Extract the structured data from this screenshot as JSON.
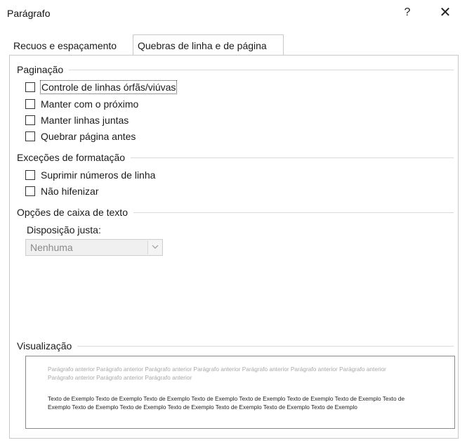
{
  "window": {
    "title": "Parágrafo",
    "help_label": "?",
    "close_label": "✕"
  },
  "tabs": [
    {
      "label": "Recuos e espaçamento",
      "selected": false
    },
    {
      "label": "Quebras de linha e de página",
      "selected": true
    }
  ],
  "pagination": {
    "header": "Paginação",
    "options": [
      {
        "label": "Controle de linhas órfãs/viúvas",
        "checked": false
      },
      {
        "label": "Manter com o próximo",
        "checked": false
      },
      {
        "label": "Manter linhas juntas",
        "checked": false
      },
      {
        "label": "Quebrar página antes",
        "checked": false
      }
    ]
  },
  "exceptions": {
    "header": "Exceções de formatação",
    "options": [
      {
        "label": "Suprimir números de linha",
        "checked": false
      },
      {
        "label": "Não hifenizar",
        "checked": false
      }
    ]
  },
  "textbox": {
    "header": "Opções de caixa de texto",
    "field_label": "Disposição justa:",
    "select_value": "Nenhuma"
  },
  "preview": {
    "header": "Visualização",
    "prior_text": "Parágrafo anterior Parágrafo anterior Parágrafo anterior Parágrafo anterior Parágrafo anterior Parágrafo anterior Parágrafo anterior Parágrafo anterior Parágrafo anterior Parágrafo anterior",
    "sample_text": "Texto de Exemplo Texto de Exemplo Texto de Exemplo Texto de Exemplo Texto de Exemplo Texto de Exemplo Texto de Exemplo Texto de Exemplo Texto de Exemplo Texto de Exemplo Texto de Exemplo Texto de Exemplo Texto de Exemplo Texto de Exemplo"
  }
}
